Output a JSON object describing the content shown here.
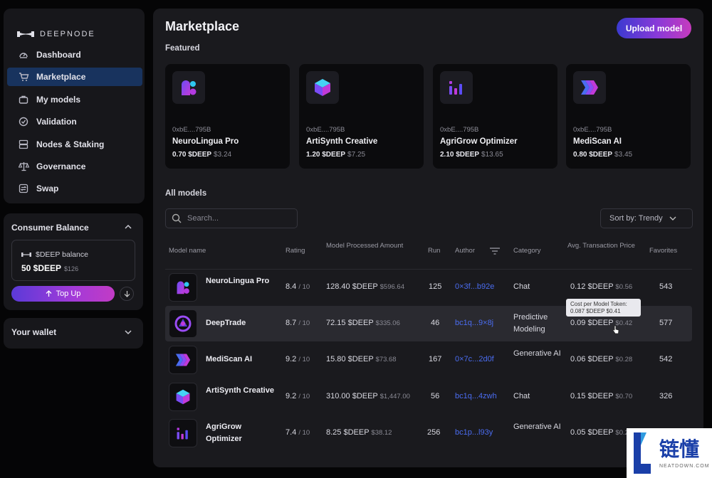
{
  "brand": {
    "name": "DEEPNODE"
  },
  "nav": [
    {
      "label": "Dashboard",
      "icon": "dashboard-icon",
      "active": false
    },
    {
      "label": "Marketplace",
      "icon": "cart-icon",
      "active": true
    },
    {
      "label": "My models",
      "icon": "briefcase-icon",
      "active": false
    },
    {
      "label": "Validation",
      "icon": "check-circle-icon",
      "active": false
    },
    {
      "label": "Nodes & Staking",
      "icon": "server-icon",
      "active": false
    },
    {
      "label": "Governance",
      "icon": "scale-icon",
      "active": false
    },
    {
      "label": "Swap",
      "icon": "swap-icon",
      "active": false
    }
  ],
  "balance": {
    "title": "Consumer Balance",
    "token_label": "$DEEP balance",
    "value": "50 $DEEP",
    "usd": "$126",
    "topup_label": "Top Up"
  },
  "wallet": {
    "title": "Your wallet"
  },
  "main": {
    "title": "Marketplace",
    "upload_label": "Upload model",
    "featured_label": "Featured",
    "all_models_label": "All models",
    "search_placeholder": "Search...",
    "sort_label": "Sort by: Trendy"
  },
  "featured": [
    {
      "addr": "0xbE....795B",
      "name": "NeuroLingua Pro",
      "price": "0.70 $DEEP",
      "usd": "$3.24",
      "icon": "neurolingua-logo-icon"
    },
    {
      "addr": "0xbE....795B",
      "name": "ArtiSynth Creative",
      "price": "1.20 $DEEP",
      "usd": "$7.25",
      "icon": "artisynth-cube-icon"
    },
    {
      "addr": "0xbE....795B",
      "name": "AgriGrow Optimizer",
      "price": "2.10 $DEEP",
      "usd": "$13.65",
      "icon": "agrigrow-bars-icon"
    },
    {
      "addr": "0xbE....795B",
      "name": "MediScan AI",
      "price": "0.80 $DEEP",
      "usd": "$3.45",
      "icon": "mediscan-logo-icon"
    }
  ],
  "table": {
    "headers": {
      "name": "Model name",
      "rating": "Rating",
      "processed": "Model Processed Amount",
      "run": "Run",
      "author": "Author",
      "category": "Category",
      "avg": "Avg. Transaction Price",
      "favorites": "Favorites"
    },
    "rows": [
      {
        "name": "NeuroLingua Pro",
        "rating": "8.4",
        "rating_max": "/ 10",
        "amount": "128.40 $DEEP",
        "amount_usd": "$596.64",
        "run": "125",
        "author": "0×3f...b92e",
        "category": "Chat",
        "avg": "0.12 $DEEP",
        "avg_usd": "$0.56",
        "fav": "543"
      },
      {
        "name": "DeepTrade",
        "rating": "8.7",
        "rating_max": "/ 10",
        "amount": "72.15 $DEEP",
        "amount_usd": "$335.06",
        "run": "46",
        "author": "bc1q...9×8j",
        "category": "Predictive Modeling",
        "avg": "0.09 $DEEP",
        "avg_usd": "$0.42",
        "fav": "577"
      },
      {
        "name": "MediScan AI",
        "rating": "9.2",
        "rating_max": "/ 10",
        "amount": "15.80 $DEEP",
        "amount_usd": "$73.68",
        "run": "167",
        "author": "0×7c...2d0f",
        "category": "Generative AI",
        "avg": "0.06 $DEEP",
        "avg_usd": "$0.28",
        "fav": "542"
      },
      {
        "name": "ArtiSynth Creative",
        "rating": "9.2",
        "rating_max": "/ 10",
        "amount": "310.00 $DEEP",
        "amount_usd": "$1,447.00",
        "run": "56",
        "author": "bc1q...4zwh",
        "category": "Chat",
        "avg": "0.15 $DEEP",
        "avg_usd": "$0.70",
        "fav": "326"
      },
      {
        "name": "AgriGrow Optimizer",
        "rating": "7.4",
        "rating_max": "/ 10",
        "amount": "8.25 $DEEP",
        "amount_usd": "$38.12",
        "run": "256",
        "author": "bc1p...l93y",
        "category": "Generative AI",
        "avg": "0.05 $DEEP",
        "avg_usd": "$0.23",
        "fav": ""
      }
    ]
  },
  "tooltip": {
    "line1": "Cost per Model Token:",
    "line2": "0.087 $DEEP $0.41"
  },
  "watermark": {
    "text": "链懂",
    "sub": "NEATDOWN.COM"
  }
}
